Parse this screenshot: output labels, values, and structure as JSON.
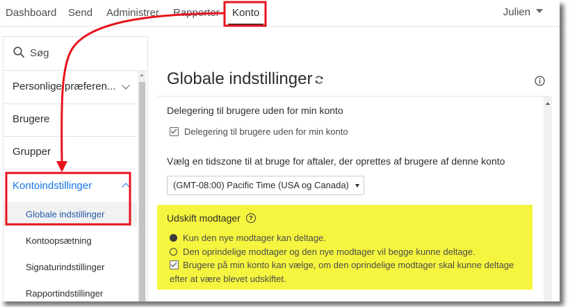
{
  "nav": {
    "items": [
      "Dashboard",
      "Send",
      "Administrer",
      "Rapporter",
      "Konto"
    ],
    "active": "Konto",
    "user": "Julien"
  },
  "sidebar": {
    "search_placeholder": "Søg",
    "items": [
      {
        "label": "Personlige præferen...",
        "chevron": "chevron-down-icon"
      },
      {
        "label": "Brugere"
      },
      {
        "label": "Grupper"
      },
      {
        "label": "Kontoindstillinger",
        "chevron": "chevron-up-icon",
        "expanded": true
      }
    ],
    "subitems": [
      "Globale indstillinger",
      "Kontoopsætning",
      "Signaturindstillinger",
      "Rapportindstillinger"
    ],
    "active_subitem": "Globale indstillinger"
  },
  "main": {
    "title": "Globale indstillinger",
    "delegation": {
      "heading": "Delegering til brugere uden for min konto",
      "checkbox_label": "Delegering til brugere uden for min konto",
      "checked": true
    },
    "timezone": {
      "heading": "Vælg en tidszone til at bruge for aftaler, der oprettes af brugere af denne konto",
      "selected": "(GMT-08:00) Pacific Time (USA og Canada)"
    },
    "replace": {
      "heading": "Udskift modtager",
      "help": "?",
      "options": [
        {
          "label": "Kun den nye modtager kan deltage.",
          "selected": true
        },
        {
          "label": "Den oprindelige modtager og den nye modtager vil begge kunne deltage.",
          "selected": false
        }
      ],
      "checkbox_label": "Brugere på min konto kan vælge, om den oprindelige modtager skal kunne deltage efter at være blevet udskiftet.",
      "checked": true
    }
  },
  "colors": {
    "annotation": "#e8121c",
    "highlight": "#f5f53f",
    "active_link": "#1473e6"
  }
}
